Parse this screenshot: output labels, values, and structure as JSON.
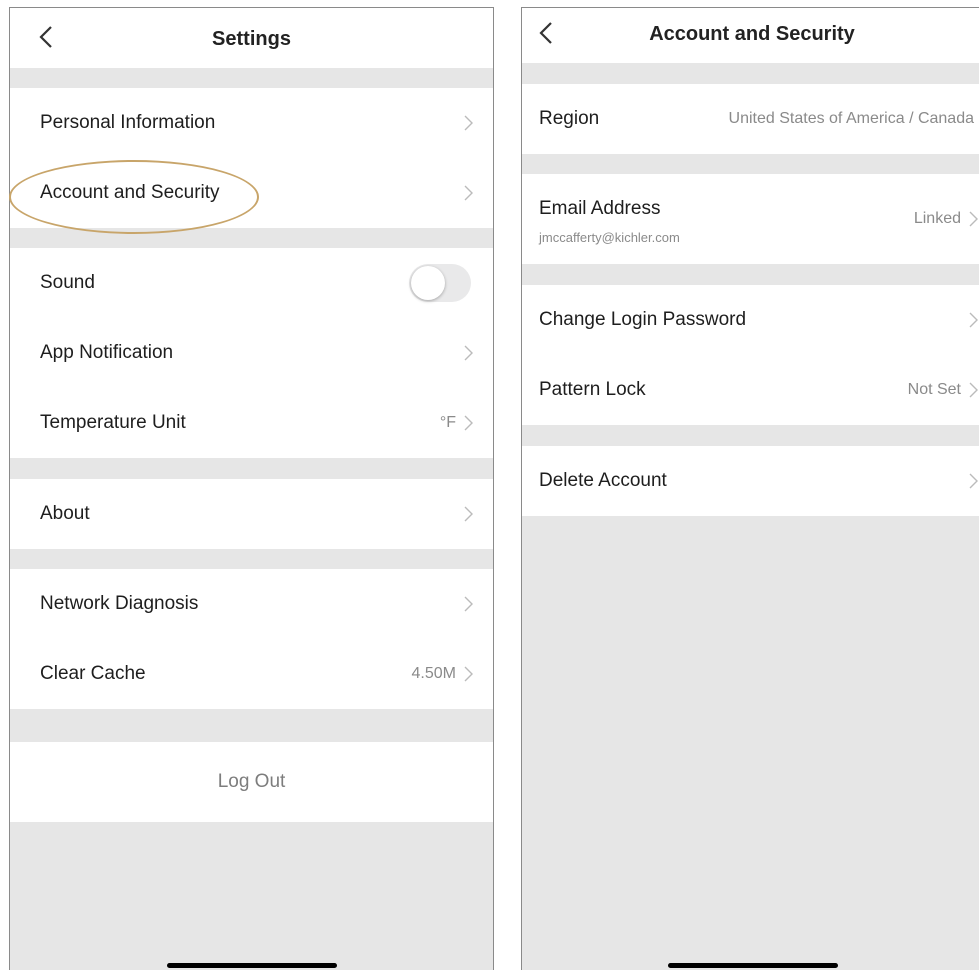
{
  "settings": {
    "title": "Settings",
    "items": {
      "personal_information": "Personal Information",
      "account_and_security": "Account and Security",
      "sound": "Sound",
      "app_notification": "App Notification",
      "temperature_unit": "Temperature Unit",
      "temperature_value": "°F",
      "about": "About",
      "network_diagnosis": "Network Diagnosis",
      "clear_cache": "Clear Cache",
      "cache_size": "4.50M"
    },
    "sound_enabled": false,
    "log_out": "Log Out"
  },
  "account_security": {
    "title": "Account and Security",
    "region_label": "Region",
    "region_value": "United States of America / Canada",
    "email_label": "Email Address",
    "email_value": "jmccafferty@kichler.com",
    "email_status": "Linked",
    "change_password": "Change Login Password",
    "pattern_lock": "Pattern Lock",
    "pattern_lock_value": "Not Set",
    "delete_account": "Delete Account"
  },
  "colors": {
    "highlight": "#c8a56a",
    "background": "#e6e6e6"
  }
}
